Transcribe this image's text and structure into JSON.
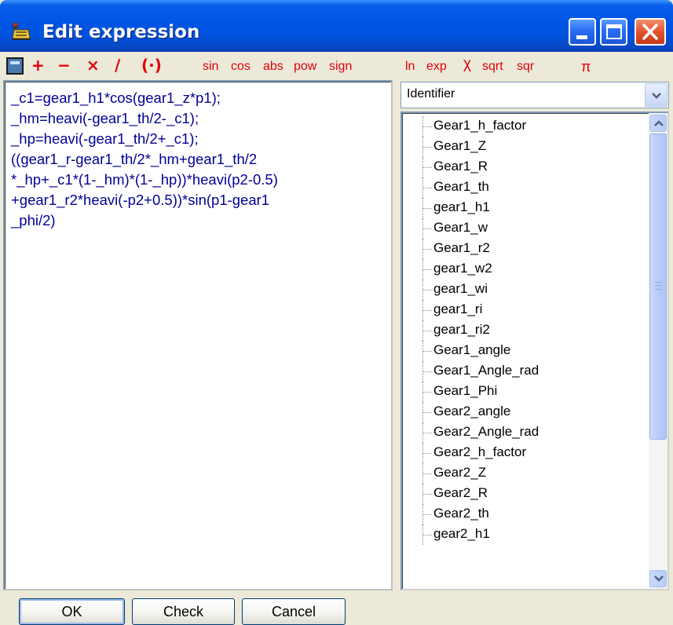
{
  "window": {
    "title": "Edit expression",
    "title_icon": "app-icon",
    "controls": [
      "minimize-icon",
      "maximize-icon",
      "close-icon"
    ]
  },
  "toolbar": {
    "calculator_icon": "calculator-icon",
    "operators": [
      "+",
      "−",
      "×",
      "/",
      "(·)"
    ],
    "functions": [
      "sin",
      "cos",
      "abs",
      "pow",
      "sign",
      "ln",
      "exp",
      "χ",
      "sqrt",
      "sqr",
      "π"
    ]
  },
  "editor": {
    "expression": "_c1=gear1_h1*cos(gear1_z*p1);\n_hm=heavi(-gear1_th/2-_c1);\n_hp=heavi(-gear1_th/2+_c1);\n((gear1_r-gear1_th/2*_hm+gear1_th/2\n*_hp+_c1*(1-_hm)*(1-_hp))*heavi(p2-0.5)\n+gear1_r2*heavi(-p2+0.5))*sin(p1-gear1\n_phi/2)"
  },
  "identifier_combo": {
    "selected": "Identifier"
  },
  "identifier_list": [
    "Gear1_h_factor",
    "Gear1_Z",
    "Gear1_R",
    "Gear1_th",
    "gear1_h1",
    "Gear1_w",
    "Gear1_r2",
    "gear1_w2",
    "gear1_wi",
    "gear1_ri",
    "gear1_ri2",
    "Gear1_angle",
    "Gear1_Angle_rad",
    "Gear1_Phi",
    "Gear2_angle",
    "Gear2_Angle_rad",
    "Gear2_h_factor",
    "Gear2_Z",
    "Gear2_R",
    "Gear2_th",
    "gear2_h1"
  ],
  "buttons": {
    "ok": "OK",
    "check": "Check",
    "cancel": "Cancel"
  },
  "colors": {
    "title_bar": "#0055e5",
    "operator_red": "#e0000b",
    "expression_text": "#000096",
    "dialog_bg": "#ece9d8"
  }
}
